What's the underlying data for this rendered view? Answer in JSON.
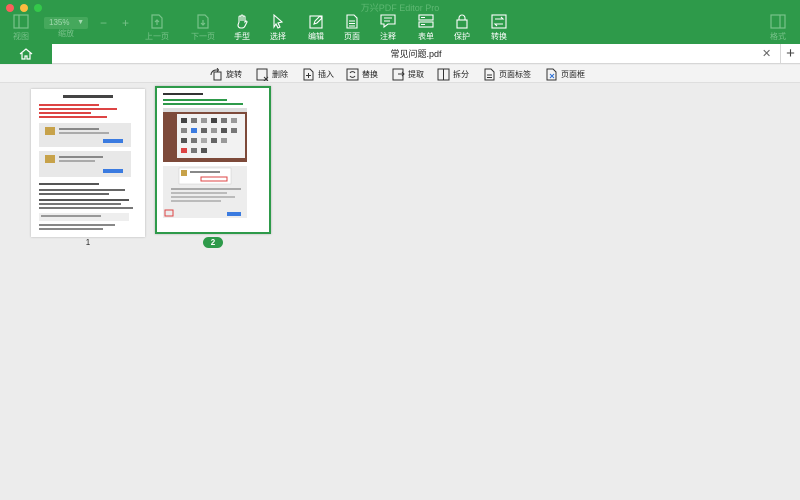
{
  "window": {
    "title": "万兴PDF Editor Pro"
  },
  "toolbar": {
    "view": "视图",
    "zoom": {
      "value": "135%",
      "label": "缩放"
    },
    "prev_page": "上一页",
    "next_page": "下一页",
    "hand": "手型",
    "select": "选择",
    "edit": "编辑",
    "page": "页面",
    "comment": "注释",
    "form": "表单",
    "protect": "保护",
    "convert": "转换",
    "format": "格式"
  },
  "tabs": {
    "active_document": "常见问题.pdf"
  },
  "page_actions": {
    "rotate": "旋转",
    "delete": "删除",
    "insert": "插入",
    "replace": "替换",
    "extract": "提取",
    "split": "拆分",
    "page_label": "页面标签",
    "page_box": "页面框"
  },
  "thumbnails": [
    {
      "page": "1",
      "selected": false
    },
    {
      "page": "2",
      "selected": true
    }
  ],
  "colors": {
    "brand": "#2e9a4a",
    "background": "#ececec"
  }
}
